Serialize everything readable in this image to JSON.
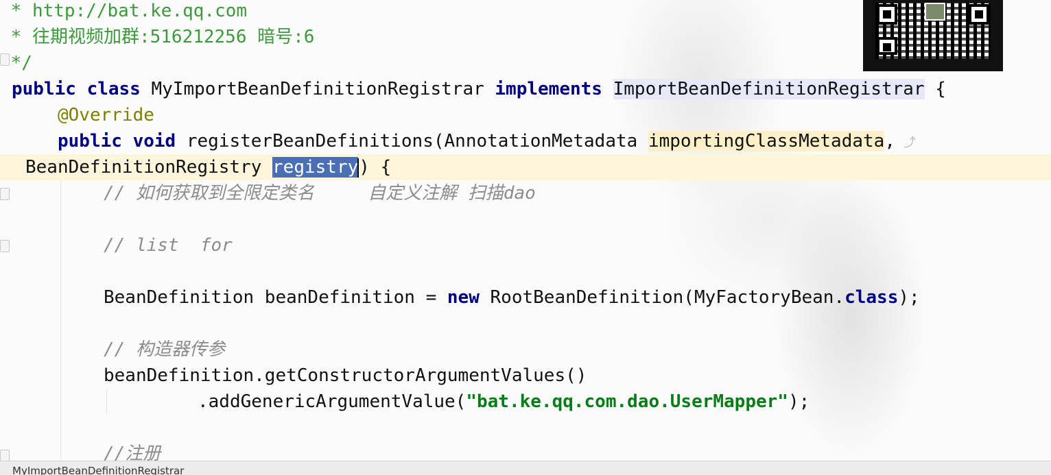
{
  "editor": {
    "lines": {
      "l1": {
        "text": " * http://bat.ke.qq.com"
      },
      "l2": {
        "text": " * 往期视频加群:516212256 暗号:6"
      },
      "l3": {
        "text": " */"
      },
      "l4": {
        "kw": "public class",
        "name": " MyImportBeanDefinitionRegistrar ",
        "impl": "implements",
        "space": " ",
        "iface": "ImportBeanDefinitionRegistrar",
        "tail": " {"
      },
      "l5": {
        "text": "@Override"
      },
      "l6": {
        "kw": "public void",
        "method": " registerBeanDefinitions(AnnotationMetadata ",
        "param": "importingClassMetadata",
        "tail": ",",
        "hint": "⤴"
      },
      "l7": {
        "head": "BeanDefinitionRegistry ",
        "param": "registry",
        "tail": ") {"
      },
      "l8": {
        "text": "// 如何获取到全限定类名     自定义注解 扫描dao"
      },
      "l9": {
        "text": "// list  for"
      },
      "l10": {
        "head": "BeanDefinition beanDefinition = ",
        "kw": "new",
        "mid": " RootBeanDefinition(MyFactoryBean.",
        "kw2": "class",
        "tail": ");"
      },
      "l11": {
        "text": "// 构造器传参"
      },
      "l12": {
        "text": "beanDefinition.getConstructorArgumentValues()"
      },
      "l13": {
        "head": ".addGenericArgumentValue(",
        "str": "\"bat.ke.qq.com.dao.UserMapper\"",
        "tail": ");"
      },
      "l14": {
        "text": "//注册"
      }
    }
  },
  "status": {
    "file": "MyImportBeanDefinitionRegistrar"
  },
  "colors": {
    "keyword": "#000080",
    "doc_comment": "#3c9a3c",
    "comment": "#8c8c8c",
    "annotation": "#808000",
    "string": "#067d17",
    "selection": "#4a6fb5",
    "current_line": "#fdf6dc"
  },
  "icons": [
    "qr-code-icon",
    "fold-marker-icon",
    "parameter-hint-icon"
  ]
}
